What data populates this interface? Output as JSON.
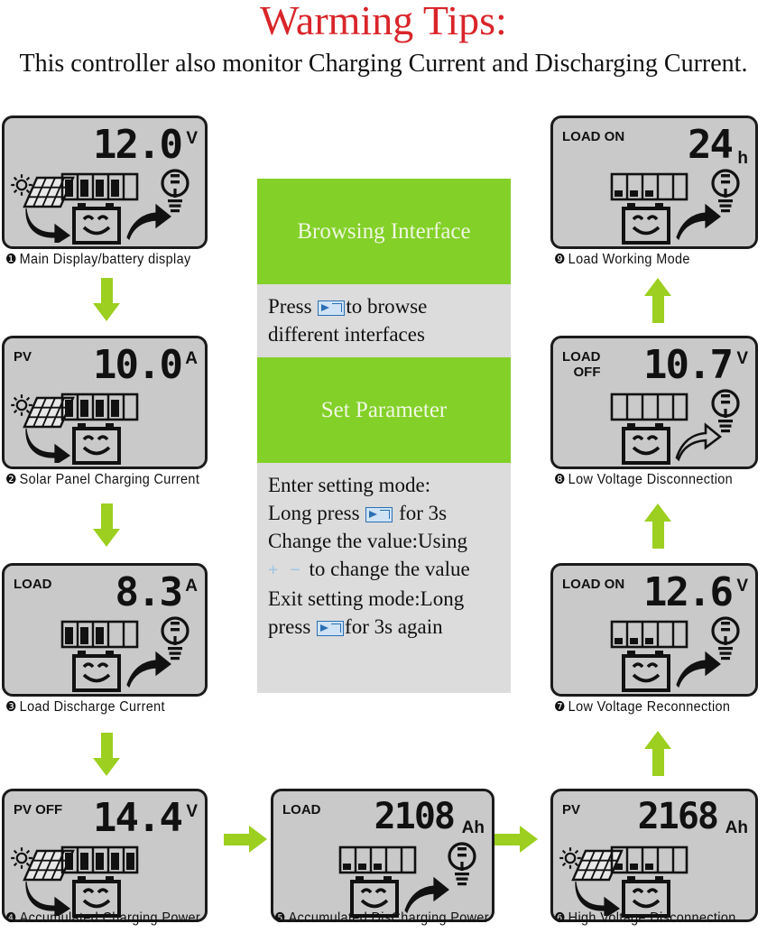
{
  "header": {
    "title": "Warming Tips:",
    "subtitle": "This controller also monitor Charging Current and Discharging Current."
  },
  "colors": {
    "title_red": "#d9252a",
    "arrow_green": "#9ccf1f",
    "band_green": "#83d028",
    "band_grey": "#dcdcdc",
    "lcd_background": "#c9c9c9",
    "lcd_border": "#1b1b1b",
    "button_icon_blue": "#2b6fb5"
  },
  "center_column": {
    "browsing_title": "Browsing Interface",
    "browsing_text_before": "Press ",
    "browsing_text_after": "to browse different interfaces",
    "set_title": "Set Parameter",
    "set_line1": "Enter setting mode:",
    "set_line2_before": "Long press ",
    "set_line2_after": " for 3s",
    "set_line3": "Change the value:Using",
    "set_line4_before": "",
    "set_line4_after": " to change the value",
    "set_line5": "Exit setting mode:Long",
    "set_line6_before": "press ",
    "set_line6_after": "for 3s again",
    "plus_minus": "+  −",
    "button_icon_name": "enter-button-icon"
  },
  "panels": [
    {
      "id": 1,
      "marker": "❶",
      "caption": "Main Display/battery display",
      "tag": "",
      "value": "12.0",
      "unit": "V",
      "has_solar": true,
      "has_bulb": true,
      "has_left_arrow": true,
      "has_right_arrow": true,
      "right_arrow_hollow": false,
      "bars": [
        2,
        2,
        2,
        2,
        0
      ],
      "battery_smile": true
    },
    {
      "id": 2,
      "marker": "❷",
      "caption": "Solar Panel Charging Current",
      "tag": "PV",
      "value": "10.0",
      "unit": "A",
      "has_solar": true,
      "has_bulb": false,
      "has_left_arrow": true,
      "has_right_arrow": false,
      "right_arrow_hollow": false,
      "bars": [
        2,
        2,
        2,
        2,
        0
      ],
      "battery_smile": true
    },
    {
      "id": 3,
      "marker": "❸",
      "caption": "Load Discharge Current",
      "tag": "LOAD",
      "value": "8.3",
      "unit": "A",
      "has_solar": false,
      "has_bulb": true,
      "has_left_arrow": false,
      "has_right_arrow": true,
      "right_arrow_hollow": false,
      "bars": [
        2,
        2,
        2,
        0,
        0
      ],
      "battery_smile": true
    },
    {
      "id": 4,
      "marker": "❹",
      "caption": "Accumulated Charging Power",
      "tag": "PV OFF",
      "value": "14.4",
      "unit": "V",
      "has_solar": true,
      "has_bulb": false,
      "has_left_arrow": true,
      "has_right_arrow": false,
      "right_arrow_hollow": false,
      "bars": [
        2,
        2,
        2,
        2,
        2
      ],
      "battery_smile": true
    },
    {
      "id": 5,
      "marker": "❺",
      "caption": "Accumulated DisCharging Power",
      "tag": "LOAD",
      "value": "2108",
      "unit": "Ah",
      "has_solar": false,
      "has_bulb": true,
      "has_left_arrow": false,
      "has_right_arrow": true,
      "right_arrow_hollow": false,
      "bars": [
        1,
        1,
        1,
        0,
        0
      ],
      "battery_smile": true
    },
    {
      "id": 6,
      "marker": "❻",
      "caption": "High Voltage Disconnection",
      "tag": "PV",
      "value": "2168",
      "unit": "Ah",
      "has_solar": true,
      "has_bulb": false,
      "has_left_arrow": true,
      "has_right_arrow": false,
      "right_arrow_hollow": false,
      "bars": [
        1,
        1,
        1,
        0,
        0
      ],
      "battery_smile": true
    },
    {
      "id": 7,
      "marker": "❼",
      "caption": "Low Voltage Reconnection",
      "tag": "LOAD ON",
      "value": "12.6",
      "unit": "V",
      "has_solar": false,
      "has_bulb": true,
      "has_left_arrow": false,
      "has_right_arrow": true,
      "right_arrow_hollow": false,
      "bars": [
        1,
        1,
        1,
        0,
        0
      ],
      "battery_smile": true
    },
    {
      "id": 8,
      "marker": "❽",
      "caption": "Low Voltage Disconnection",
      "tag": "LOAD\n   OFF",
      "value": "10.7",
      "unit": "V",
      "has_solar": false,
      "has_bulb": true,
      "has_left_arrow": false,
      "has_right_arrow": true,
      "right_arrow_hollow": true,
      "bars": [
        0,
        0,
        0,
        0,
        0
      ],
      "battery_smile": true
    },
    {
      "id": 9,
      "marker": "❾",
      "caption": "Load Working Mode",
      "tag": "LOAD ON",
      "value": "24",
      "unit": "h",
      "has_solar": false,
      "has_bulb": true,
      "has_left_arrow": false,
      "has_right_arrow": true,
      "right_arrow_hollow": false,
      "bars": [
        1,
        1,
        1,
        0,
        0
      ],
      "battery_smile": true
    }
  ],
  "connectors": [
    {
      "name": "arrow-1-to-2",
      "direction": "down"
    },
    {
      "name": "arrow-2-to-3",
      "direction": "down"
    },
    {
      "name": "arrow-3-to-4",
      "direction": "down"
    },
    {
      "name": "arrow-4-to-5",
      "direction": "right"
    },
    {
      "name": "arrow-5-to-6",
      "direction": "right"
    },
    {
      "name": "arrow-6-to-7",
      "direction": "up"
    },
    {
      "name": "arrow-7-to-8",
      "direction": "up"
    },
    {
      "name": "arrow-8-to-9",
      "direction": "up"
    }
  ]
}
